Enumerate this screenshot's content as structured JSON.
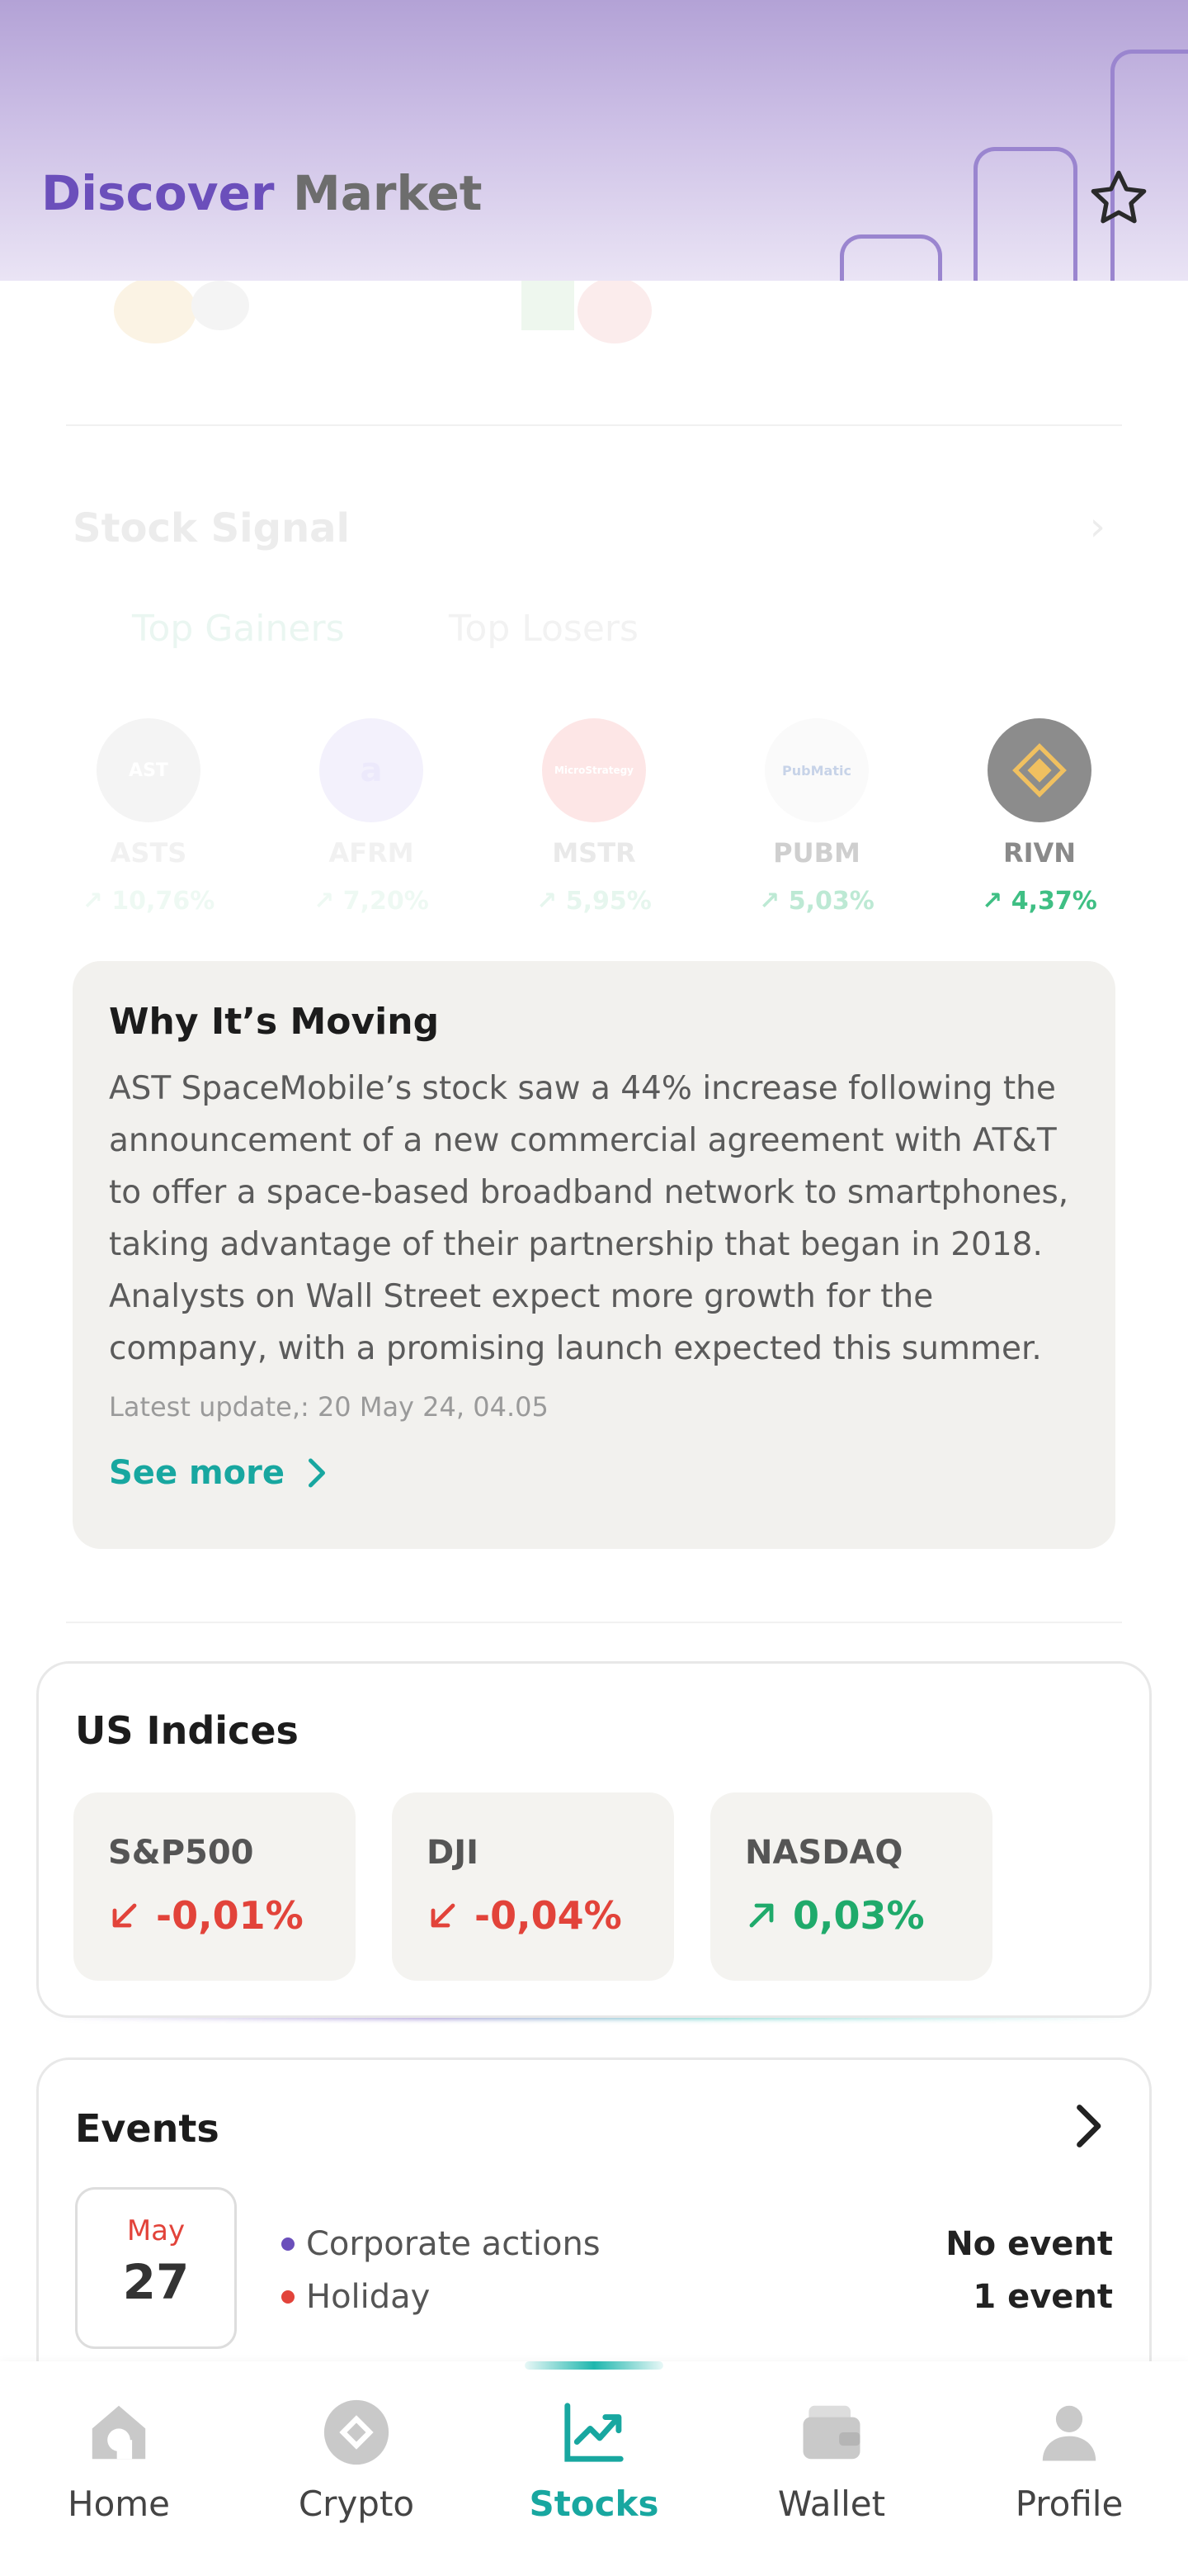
{
  "header": {
    "tabs": [
      {
        "label": "Discover",
        "active": true
      },
      {
        "label": "Market",
        "active": false
      }
    ],
    "favorite_icon": "star-outline-icon",
    "accent_color": "#6b4fbb"
  },
  "stock_signal": {
    "title": "Stock Signal",
    "tabs": [
      "Top Gainers",
      "Top Losers"
    ],
    "stocks": [
      {
        "ticker": "ASTS",
        "change": "10,76%",
        "logo_text": "AST"
      },
      {
        "ticker": "AFRM",
        "change": "7,20%",
        "logo_text": "a"
      },
      {
        "ticker": "MSTR",
        "change": "5,95%",
        "logo_text": "MicroStrategy"
      },
      {
        "ticker": "PUBM",
        "change": "5,03%",
        "logo_text": "PubMatic"
      },
      {
        "ticker": "RIVN",
        "change": "4,37%",
        "logo_text": ""
      }
    ]
  },
  "why_moving": {
    "title": "Why It’s Moving",
    "body": "AST SpaceMobile’s stock saw a 44% increase following the announcement of a new commercial agreement with AT&T to offer a space-based broadband network to smartphones, taking advantage of their partnership that began in 2018. Analysts on Wall Street expect more growth for the company, with a promising launch expected this summer.",
    "update": "Latest update,: 20 May 24, 04.05",
    "link": "See more"
  },
  "indices": {
    "title": "US Indices",
    "items": [
      {
        "name": "S&P500",
        "value": "-0,01%",
        "direction": "down"
      },
      {
        "name": "DJI",
        "value": "-0,04%",
        "direction": "down"
      },
      {
        "name": "NASDAQ",
        "value": "0,03%",
        "direction": "up"
      }
    ]
  },
  "events": {
    "title": "Events",
    "month": "May",
    "day": "27",
    "rows": [
      {
        "label": "Corporate actions",
        "count": "No event",
        "dot_color": "#6b4fbb"
      },
      {
        "label": "Holiday",
        "count": "1 event",
        "dot_color": "#e2433a"
      }
    ]
  },
  "nav": {
    "items": [
      {
        "label": "Home",
        "icon": "home-icon"
      },
      {
        "label": "Crypto",
        "icon": "crypto-icon"
      },
      {
        "label": "Stocks",
        "icon": "stocks-chart-icon",
        "active": true
      },
      {
        "label": "Wallet",
        "icon": "wallet-icon"
      },
      {
        "label": "Profile",
        "icon": "profile-icon"
      }
    ]
  }
}
